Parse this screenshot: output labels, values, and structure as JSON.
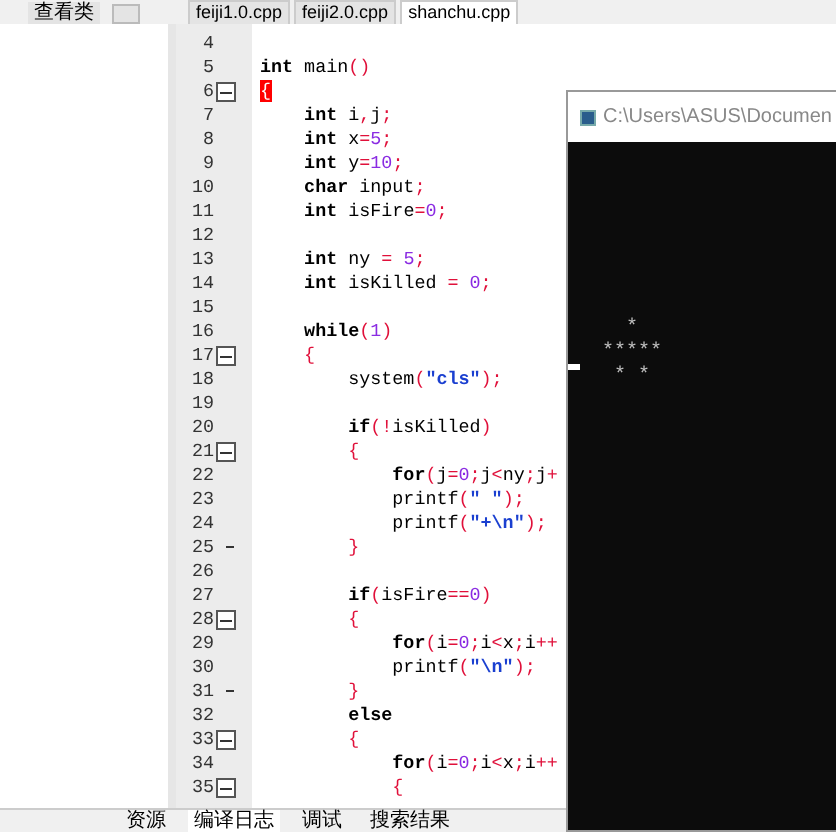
{
  "panel_tabs": [
    {
      "label": "查看类",
      "selected": false
    }
  ],
  "file_tabs": [
    {
      "label": "feiji1.0.cpp",
      "selected": false
    },
    {
      "label": "feiji2.0.cpp",
      "selected": false
    },
    {
      "label": "shanchu.cpp",
      "selected": true
    }
  ],
  "code_lines": [
    {
      "number": "4",
      "kind": "line"
    },
    {
      "number": "5",
      "kind": "line",
      "tokens": [
        {
          "kind": "keyword",
          "text": "int"
        },
        {
          "kind": "plain",
          "text": " main"
        },
        {
          "kind": "op",
          "text": "()"
        }
      ]
    },
    {
      "number": "6",
      "kind": "fold-start",
      "tokens": [
        {
          "kind": "match",
          "text": "{"
        }
      ]
    },
    {
      "number": "7",
      "kind": "line",
      "tokens": [
        {
          "kind": "keyword",
          "text": "    int"
        },
        {
          "kind": "plain",
          "text": " i"
        },
        {
          "kind": "op",
          "text": ","
        },
        {
          "kind": "plain",
          "text": "j"
        },
        {
          "kind": "op",
          "text": ";"
        }
      ]
    },
    {
      "number": "8",
      "kind": "line",
      "tokens": [
        {
          "kind": "keyword",
          "text": "    int"
        },
        {
          "kind": "plain",
          "text": " x"
        },
        {
          "kind": "op",
          "text": "="
        },
        {
          "kind": "number",
          "text": "5"
        },
        {
          "kind": "op",
          "text": ";"
        }
      ]
    },
    {
      "number": "9",
      "kind": "line",
      "tokens": [
        {
          "kind": "keyword",
          "text": "    int"
        },
        {
          "kind": "plain",
          "text": " y"
        },
        {
          "kind": "op",
          "text": "="
        },
        {
          "kind": "number",
          "text": "10"
        },
        {
          "kind": "op",
          "text": ";"
        }
      ]
    },
    {
      "number": "10",
      "kind": "line",
      "tokens": [
        {
          "kind": "keyword",
          "text": "    char"
        },
        {
          "kind": "plain",
          "text": " input"
        },
        {
          "kind": "op",
          "text": ";"
        }
      ]
    },
    {
      "number": "11",
      "kind": "line",
      "tokens": [
        {
          "kind": "keyword",
          "text": "    int"
        },
        {
          "kind": "plain",
          "text": " isFire"
        },
        {
          "kind": "op",
          "text": "="
        },
        {
          "kind": "number",
          "text": "0"
        },
        {
          "kind": "op",
          "text": ";"
        }
      ]
    },
    {
      "number": "12",
      "kind": "line"
    },
    {
      "number": "13",
      "kind": "line",
      "tokens": [
        {
          "kind": "keyword",
          "text": "    int"
        },
        {
          "kind": "plain",
          "text": " ny "
        },
        {
          "kind": "op",
          "text": "="
        },
        {
          "kind": "number",
          "text": " 5"
        },
        {
          "kind": "op",
          "text": ";"
        }
      ]
    },
    {
      "number": "14",
      "kind": "line",
      "tokens": [
        {
          "kind": "keyword",
          "text": "    int"
        },
        {
          "kind": "plain",
          "text": " isKilled "
        },
        {
          "kind": "op",
          "text": "="
        },
        {
          "kind": "number",
          "text": " 0"
        },
        {
          "kind": "op",
          "text": ";"
        }
      ]
    },
    {
      "number": "15",
      "kind": "line"
    },
    {
      "number": "16",
      "kind": "line",
      "tokens": [
        {
          "kind": "keyword",
          "text": "    while"
        },
        {
          "kind": "op",
          "text": "("
        },
        {
          "kind": "number",
          "text": "1"
        },
        {
          "kind": "op",
          "text": ")"
        }
      ]
    },
    {
      "number": "17",
      "kind": "fold-start",
      "tokens": [
        {
          "kind": "op",
          "text": "    {"
        }
      ]
    },
    {
      "number": "18",
      "kind": "line",
      "tokens": [
        {
          "kind": "plain",
          "text": "        system"
        },
        {
          "kind": "op",
          "text": "("
        },
        {
          "kind": "string",
          "text": "\"cls\""
        },
        {
          "kind": "op",
          "text": ");"
        }
      ]
    },
    {
      "number": "19",
      "kind": "line"
    },
    {
      "number": "20",
      "kind": "line",
      "tokens": [
        {
          "kind": "keyword",
          "text": "        if"
        },
        {
          "kind": "op",
          "text": "(!"
        },
        {
          "kind": "plain",
          "text": "isKilled"
        },
        {
          "kind": "op",
          "text": ")"
        }
      ]
    },
    {
      "number": "21",
      "kind": "fold-start",
      "tokens": [
        {
          "kind": "op",
          "text": "        {"
        }
      ]
    },
    {
      "number": "22",
      "kind": "line",
      "tokens": [
        {
          "kind": "keyword",
          "text": "            for"
        },
        {
          "kind": "op",
          "text": "("
        },
        {
          "kind": "plain",
          "text": "j"
        },
        {
          "kind": "op",
          "text": "="
        },
        {
          "kind": "number",
          "text": "0"
        },
        {
          "kind": "op",
          "text": ";"
        },
        {
          "kind": "plain",
          "text": "j"
        },
        {
          "kind": "op",
          "text": "<"
        },
        {
          "kind": "plain",
          "text": "ny"
        },
        {
          "kind": "op",
          "text": ";"
        },
        {
          "kind": "plain",
          "text": "j"
        },
        {
          "kind": "op",
          "text": "+"
        }
      ]
    },
    {
      "number": "23",
      "kind": "line",
      "tokens": [
        {
          "kind": "plain",
          "text": "            printf"
        },
        {
          "kind": "op",
          "text": "("
        },
        {
          "kind": "string",
          "text": "\" \""
        },
        {
          "kind": "op",
          "text": ");"
        }
      ]
    },
    {
      "number": "24",
      "kind": "line",
      "tokens": [
        {
          "kind": "plain",
          "text": "            printf"
        },
        {
          "kind": "op",
          "text": "("
        },
        {
          "kind": "string",
          "text": "\"+\\n\""
        },
        {
          "kind": "op",
          "text": ");"
        }
      ]
    },
    {
      "number": "25",
      "kind": "fold-end",
      "tokens": [
        {
          "kind": "op",
          "text": "        }"
        }
      ]
    },
    {
      "number": "26",
      "kind": "line"
    },
    {
      "number": "27",
      "kind": "line",
      "tokens": [
        {
          "kind": "keyword",
          "text": "        if"
        },
        {
          "kind": "op",
          "text": "("
        },
        {
          "kind": "plain",
          "text": "isFire"
        },
        {
          "kind": "op",
          "text": "=="
        },
        {
          "kind": "number",
          "text": "0"
        },
        {
          "kind": "op",
          "text": ")"
        }
      ]
    },
    {
      "number": "28",
      "kind": "fold-start",
      "tokens": [
        {
          "kind": "op",
          "text": "        {"
        }
      ]
    },
    {
      "number": "29",
      "kind": "line",
      "tokens": [
        {
          "kind": "keyword",
          "text": "            for"
        },
        {
          "kind": "op",
          "text": "("
        },
        {
          "kind": "plain",
          "text": "i"
        },
        {
          "kind": "op",
          "text": "="
        },
        {
          "kind": "number",
          "text": "0"
        },
        {
          "kind": "op",
          "text": ";"
        },
        {
          "kind": "plain",
          "text": "i"
        },
        {
          "kind": "op",
          "text": "<"
        },
        {
          "kind": "plain",
          "text": "x"
        },
        {
          "kind": "op",
          "text": ";"
        },
        {
          "kind": "plain",
          "text": "i"
        },
        {
          "kind": "op",
          "text": "++"
        }
      ]
    },
    {
      "number": "30",
      "kind": "line",
      "tokens": [
        {
          "kind": "plain",
          "text": "            printf"
        },
        {
          "kind": "op",
          "text": "("
        },
        {
          "kind": "string",
          "text": "\"\\n\""
        },
        {
          "kind": "op",
          "text": ");"
        }
      ]
    },
    {
      "number": "31",
      "kind": "fold-end",
      "tokens": [
        {
          "kind": "op",
          "text": "        }"
        }
      ]
    },
    {
      "number": "32",
      "kind": "line",
      "tokens": [
        {
          "kind": "keyword",
          "text": "        else"
        }
      ]
    },
    {
      "number": "33",
      "kind": "fold-start",
      "tokens": [
        {
          "kind": "op",
          "text": "        {"
        }
      ]
    },
    {
      "number": "34",
      "kind": "line",
      "tokens": [
        {
          "kind": "keyword",
          "text": "            for"
        },
        {
          "kind": "op",
          "text": "("
        },
        {
          "kind": "plain",
          "text": "i"
        },
        {
          "kind": "op",
          "text": "="
        },
        {
          "kind": "number",
          "text": "0"
        },
        {
          "kind": "op",
          "text": ";"
        },
        {
          "kind": "plain",
          "text": "i"
        },
        {
          "kind": "op",
          "text": "<"
        },
        {
          "kind": "plain",
          "text": "x"
        },
        {
          "kind": "op",
          "text": ";"
        },
        {
          "kind": "plain",
          "text": "i"
        },
        {
          "kind": "op",
          "text": "++"
        }
      ]
    },
    {
      "number": "35",
      "kind": "fold-start",
      "tokens": [
        {
          "kind": "op",
          "text": "            {"
        }
      ]
    }
  ],
  "console": {
    "title": "C:\\Users\\ASUS\\Documen",
    "output_lines": [
      "  *",
      "*****",
      " * *"
    ]
  },
  "bottom_tabs": [
    {
      "label": "资源",
      "selected": false
    },
    {
      "label": "编译日志",
      "selected": true
    },
    {
      "label": "调试",
      "selected": false
    },
    {
      "label": "搜索结果",
      "selected": false
    }
  ]
}
